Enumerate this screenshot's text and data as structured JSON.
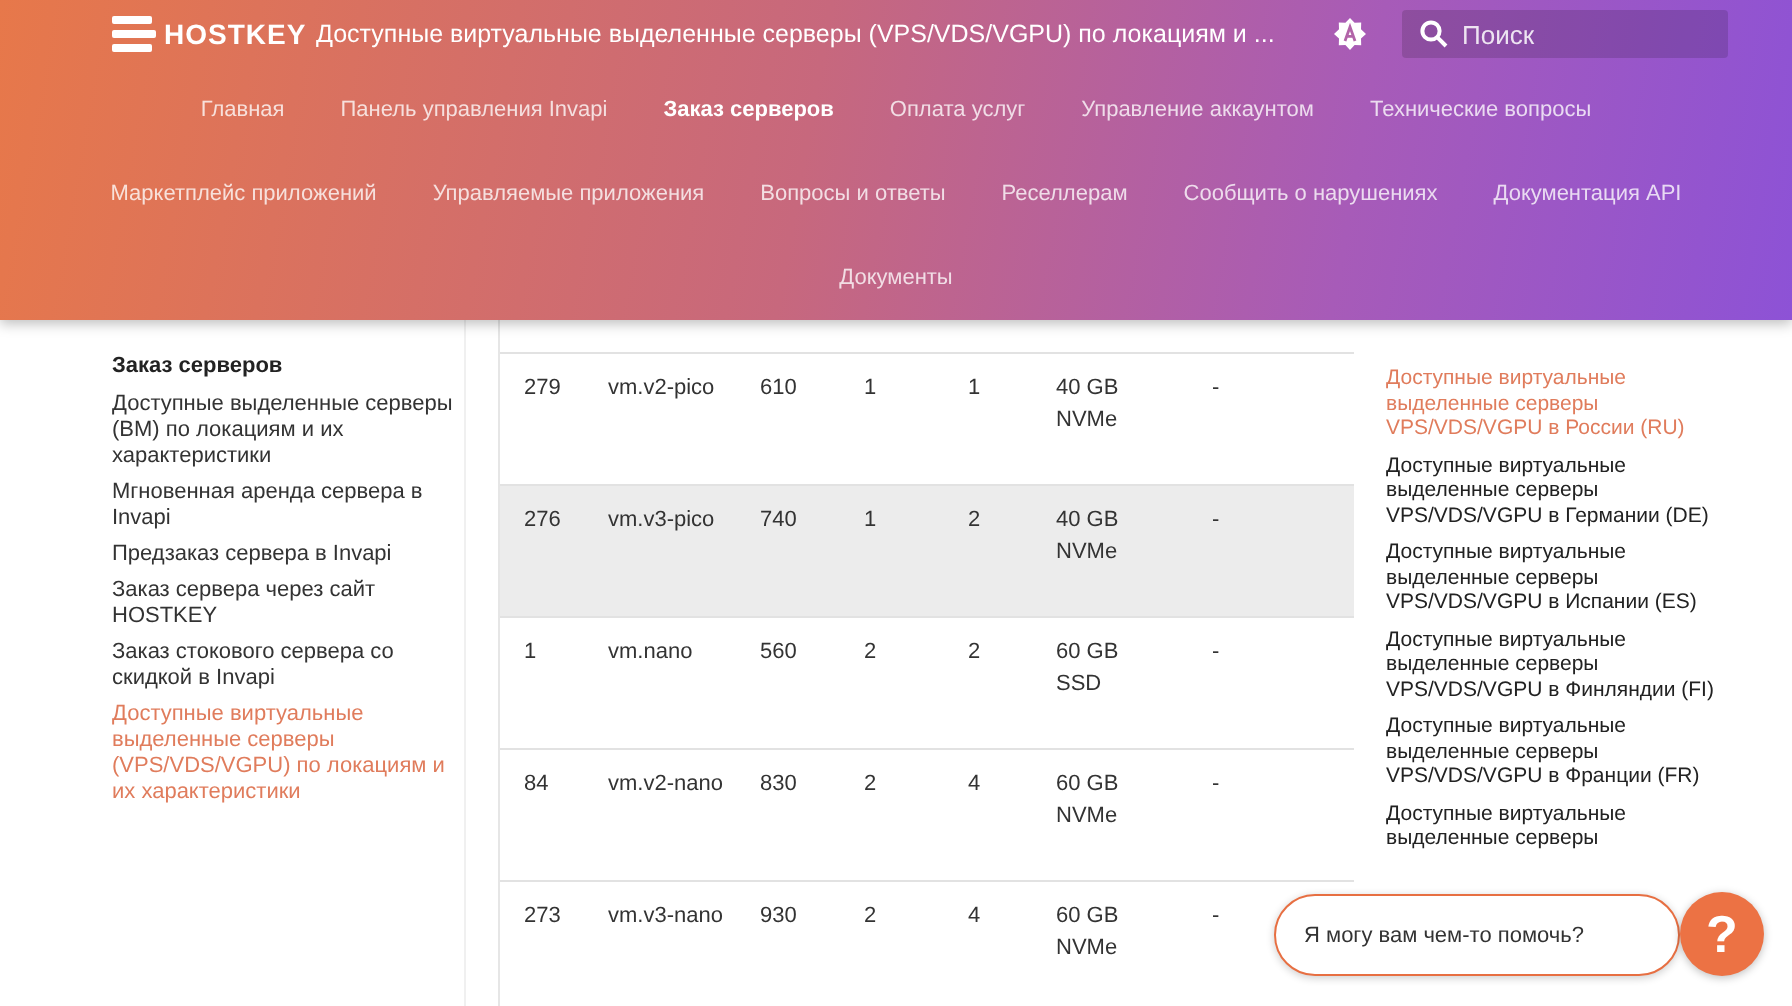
{
  "header": {
    "logo": "HOSTKEY",
    "title": "Доступные виртуальные выделенные серверы (VPS/VDS/VGPU) по локациям и ...",
    "search": {
      "placeholder": "Поиск"
    }
  },
  "nav_rows": [
    [
      {
        "label": "Главная",
        "selected": false
      },
      {
        "label": "Панель управления Invapi",
        "selected": false
      },
      {
        "label": "Заказ серверов",
        "selected": true
      },
      {
        "label": "Оплата услуг",
        "selected": false
      },
      {
        "label": "Управление аккаунтом",
        "selected": false
      },
      {
        "label": "Технические вопросы",
        "selected": false
      }
    ],
    [
      {
        "label": "Маркетплейс приложений",
        "selected": false
      },
      {
        "label": "Управляемые приложения",
        "selected": false
      },
      {
        "label": "Вопросы и ответы",
        "selected": false
      },
      {
        "label": "Реселлерам",
        "selected": false
      },
      {
        "label": "Сообщить о нарушениях",
        "selected": false
      },
      {
        "label": "Документация API",
        "selected": false
      }
    ],
    [
      {
        "label": "Документы",
        "selected": false
      }
    ]
  ],
  "sidebar": {
    "title": "Заказ серверов",
    "items": [
      {
        "label": "Доступные выделенные серверы (BM) по локациям и их характеристики",
        "selected": false
      },
      {
        "label": "Мгновенная аренда сервера в Invapi",
        "selected": false
      },
      {
        "label": "Предзаказ сервера в Invapi",
        "selected": false
      },
      {
        "label": "Заказ сервера через сайт HOSTKEY",
        "selected": false
      },
      {
        "label": "Заказ стокового сервера со скидкой в Invapi",
        "selected": false
      },
      {
        "label": "Доступные виртуальные выделенные серверы (VPS/VDS/VGPU) по локациям и их характеристики",
        "selected": true
      }
    ]
  },
  "table": {
    "rows": [
      {
        "cells": [
          "279",
          "vm.v2-pico",
          "610",
          "1",
          "1",
          "40 GB NVMe",
          "-"
        ],
        "highlighted": false
      },
      {
        "cells": [
          "276",
          "vm.v3-pico",
          "740",
          "1",
          "2",
          "40 GB NVMe",
          "-"
        ],
        "highlighted": true
      },
      {
        "cells": [
          "1",
          "vm.nano",
          "560",
          "2",
          "2",
          "60 GB SSD",
          "-"
        ],
        "highlighted": false
      },
      {
        "cells": [
          "84",
          "vm.v2-nano",
          "830",
          "2",
          "4",
          "60 GB NVMe",
          "-"
        ],
        "highlighted": false
      },
      {
        "cells": [
          "273",
          "vm.v3-nano",
          "930",
          "2",
          "4",
          "60 GB NVMe",
          "-"
        ],
        "highlighted": false
      }
    ]
  },
  "toc": [
    {
      "label": "Доступные виртуальные выделенные серверы VPS/VDS/VGPU в России (RU)",
      "selected": true
    },
    {
      "label": "Доступные виртуальные выделенные серверы VPS/VDS/VGPU в Германии (DE)",
      "selected": false
    },
    {
      "label": "Доступные виртуальные выделенные серверы VPS/VDS/VGPU в Испании (ES)",
      "selected": false
    },
    {
      "label": "Доступные виртуальные выделенные серверы VPS/VDS/VGPU в Финляндии (FI)",
      "selected": false
    },
    {
      "label": "Доступные виртуальные выделенные серверы VPS/VDS/VGPU в Франции (FR)",
      "selected": false
    },
    {
      "label": "Доступные виртуальные выделенные серверы",
      "selected": false
    }
  ],
  "chat": {
    "message": "Я могу вам чем-то помочь?",
    "button": "?"
  }
}
